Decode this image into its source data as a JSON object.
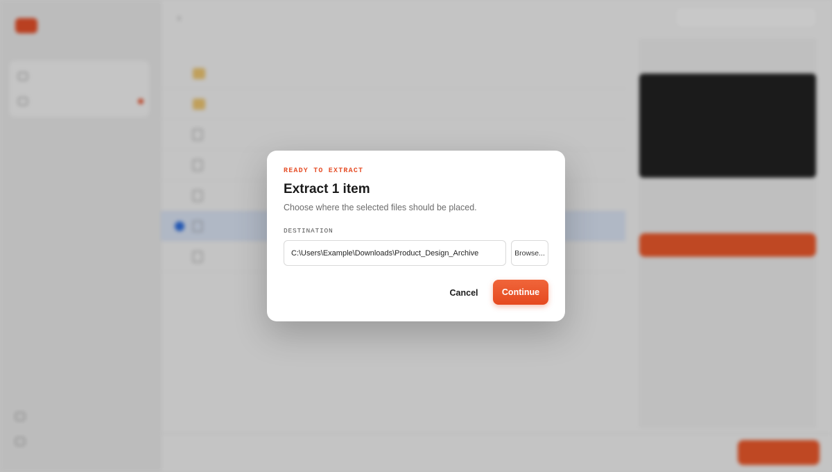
{
  "colors": {
    "accent": "#E6502A",
    "selection": "#2F6FE0"
  },
  "background": {
    "sidebar": {
      "items": [
        {
          "icon": "folder-icon"
        },
        {
          "icon": "queue-icon"
        }
      ],
      "bottom_items": [
        {
          "icon": "history-icon"
        },
        {
          "icon": "settings-icon"
        }
      ]
    }
  },
  "dialog": {
    "eyebrow": "READY TO EXTRACT",
    "title": "Extract 1 item",
    "subtitle": "Choose where the selected files should be placed.",
    "destination_label": "DESTINATION",
    "destination_value": "C:\\Users\\Example\\Downloads\\Product_Design_Archive",
    "browse_label": "Browse...",
    "cancel_label": "Cancel",
    "continue_label": "Continue"
  }
}
